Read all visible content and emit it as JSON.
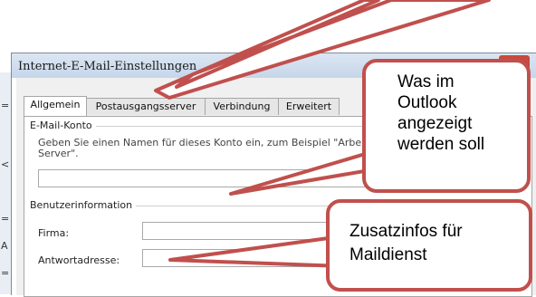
{
  "window": {
    "title": "Internet-E-Mail-Einstellungen",
    "close_glyph": "✕"
  },
  "tabs": [
    {
      "label": "Allgemein",
      "active": true
    },
    {
      "label": "Postausgangsserver",
      "active": false
    },
    {
      "label": "Verbindung",
      "active": false
    },
    {
      "label": "Erweitert",
      "active": false
    }
  ],
  "email_account": {
    "group_label": "E-Mail-Konto",
    "description_line1": "Geben Sie einen Namen für dieses Konto ein, zum Beispiel \"Arbeit\" oder \"Microsoft Mail",
    "description_line2": "Server\".",
    "account_name_value": ""
  },
  "user_info": {
    "group_label": "Benutzerinformation",
    "company_label": "Firma:",
    "company_value": "",
    "reply_label": "Antwortadresse:",
    "reply_value": ""
  },
  "callouts": {
    "callout1_line1": "Was im",
    "callout1_line2": "Outlook",
    "callout1_line3": "angezeigt",
    "callout1_line4": "werden soll",
    "callout2_line1": "Zusatzinfos für",
    "callout2_line2": "Maildienst",
    "accent_color": "#c0504d"
  }
}
